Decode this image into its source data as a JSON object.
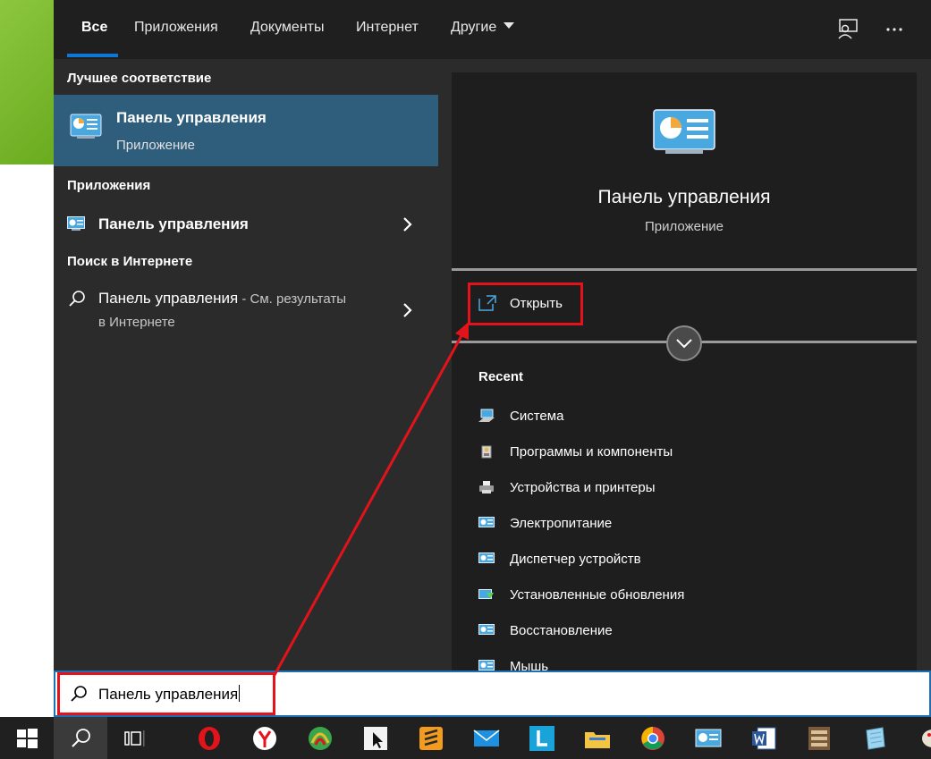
{
  "tabs": {
    "all": "Все",
    "apps": "Приложения",
    "documents": "Документы",
    "web": "Интернет",
    "other": "Другие"
  },
  "left": {
    "best_match_title": "Лучшее соответствие",
    "best_match": {
      "title": "Панель управления",
      "subtitle": "Приложение"
    },
    "apps_title": "Приложения",
    "apps_item": "Панель управления",
    "web_title": "Поиск в Интернете",
    "web_item": {
      "title": "Панель управления",
      "suffix": " - См. результаты",
      "line2": "в Интернете"
    }
  },
  "preview": {
    "title": "Панель управления",
    "subtitle": "Приложение",
    "open_label": "Открыть",
    "recent_title": "Recent",
    "recent": [
      {
        "label": "Система",
        "icon": "system-icon"
      },
      {
        "label": "Программы и компоненты",
        "icon": "programs-icon"
      },
      {
        "label": "Устройства и принтеры",
        "icon": "printer-icon"
      },
      {
        "label": "Электропитание",
        "icon": "control-panel-icon"
      },
      {
        "label": "Диспетчер устройств",
        "icon": "control-panel-icon"
      },
      {
        "label": "Установленные обновления",
        "icon": "updates-icon"
      },
      {
        "label": "Восстановление",
        "icon": "control-panel-icon"
      },
      {
        "label": "Мышь",
        "icon": "control-panel-icon"
      }
    ]
  },
  "search": {
    "value": "Панель управления"
  },
  "colors": {
    "accent": "#0a78d4",
    "highlight": "#e3131b",
    "selected": "#2f5d7c"
  }
}
